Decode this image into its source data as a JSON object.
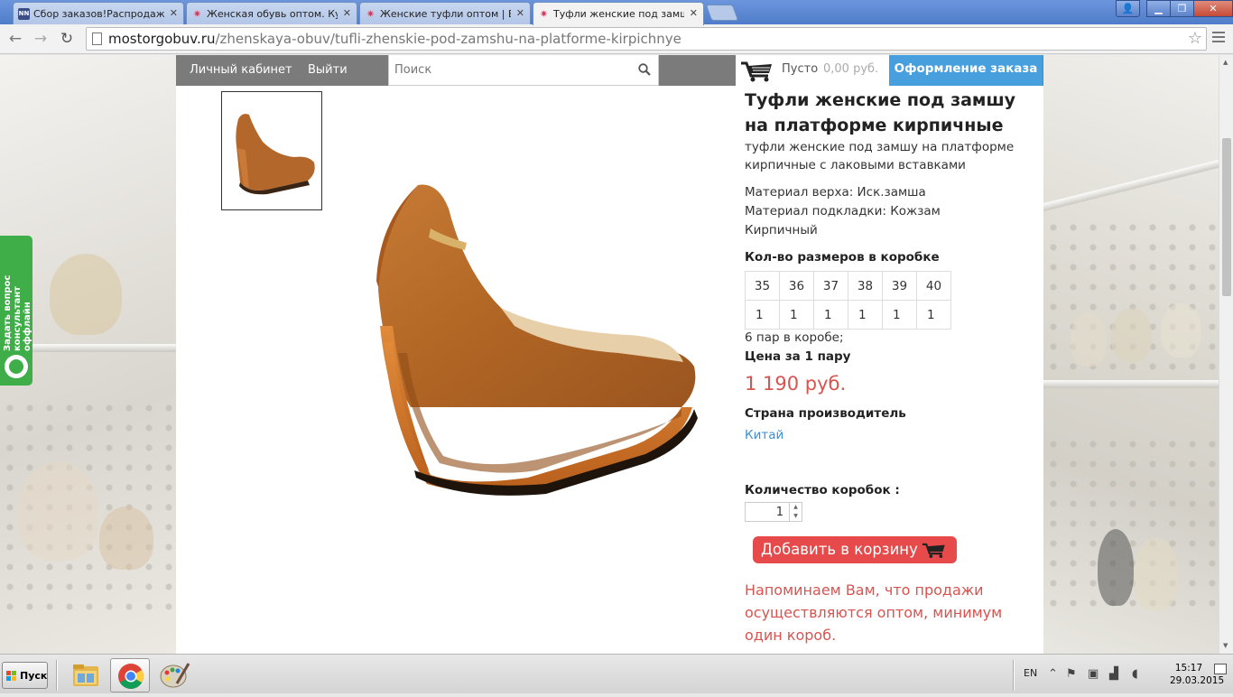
{
  "browser": {
    "tabs": [
      {
        "title": "Сбор заказов!Распродажа д",
        "icon": "nn-favicon",
        "active": false
      },
      {
        "title": "Женская обувь оптом. Купи",
        "icon": "star-favicon",
        "active": false
      },
      {
        "title": "Женские туфли оптом | Ве",
        "icon": "star-favicon",
        "active": false
      },
      {
        "title": "Туфли женские под замшу",
        "icon": "star-favicon",
        "active": true
      }
    ],
    "close_glyph": "✕",
    "url_host": "mostorgobuv.ru",
    "url_path": "/zhenskaya-obuv/tufli-zhenskie-pod-zamshu-na-platforme-kirpichnye"
  },
  "header": {
    "account_link": "Личный кабинет",
    "logout_link": "Выйти",
    "search_placeholder": "Поиск",
    "cart_status": "Пусто",
    "cart_sum": "0,00 руб.",
    "checkout_label": "Оформление заказа"
  },
  "product": {
    "title": "Туфли женские под замшу на платформе кирпичные",
    "description": "туфли женские под замшу на платформе кирпичные с лаковыми вставками",
    "attributes": [
      "Материал верха: Иск.замша",
      "Материал подкладки: Кожзам",
      "Кирпичный"
    ],
    "sizes_heading": "Кол-во размеров в коробке",
    "sizes": [
      "35",
      "36",
      "37",
      "38",
      "39",
      "40"
    ],
    "quantities": [
      "1",
      "1",
      "1",
      "1",
      "1",
      "1"
    ],
    "pairs_in_box": "6 пар в коробе;",
    "price_label": "Цена за 1 пару",
    "price": "1 190 руб.",
    "country_label": "Страна производитель",
    "country": "Китай",
    "quantity_label": "Количество коробок :",
    "quantity_value": "1",
    "add_to_cart": "Добавить в корзину",
    "notice": "Напоминаем Вам, что продажи осуществляются оптом, минимум один короб.",
    "color": "#b86b2c"
  },
  "widget": {
    "line1": "Задать вопрос",
    "line2": "консультант оффлайн"
  },
  "taskbar": {
    "start_label": "Пуск",
    "language": "EN",
    "time": "15:17",
    "date": "29.03.2015"
  },
  "colors": {
    "accent_blue": "#47a0dd",
    "price_red": "#d9534f",
    "button_red": "#e64a4a",
    "widget_green": "#3fae49"
  }
}
